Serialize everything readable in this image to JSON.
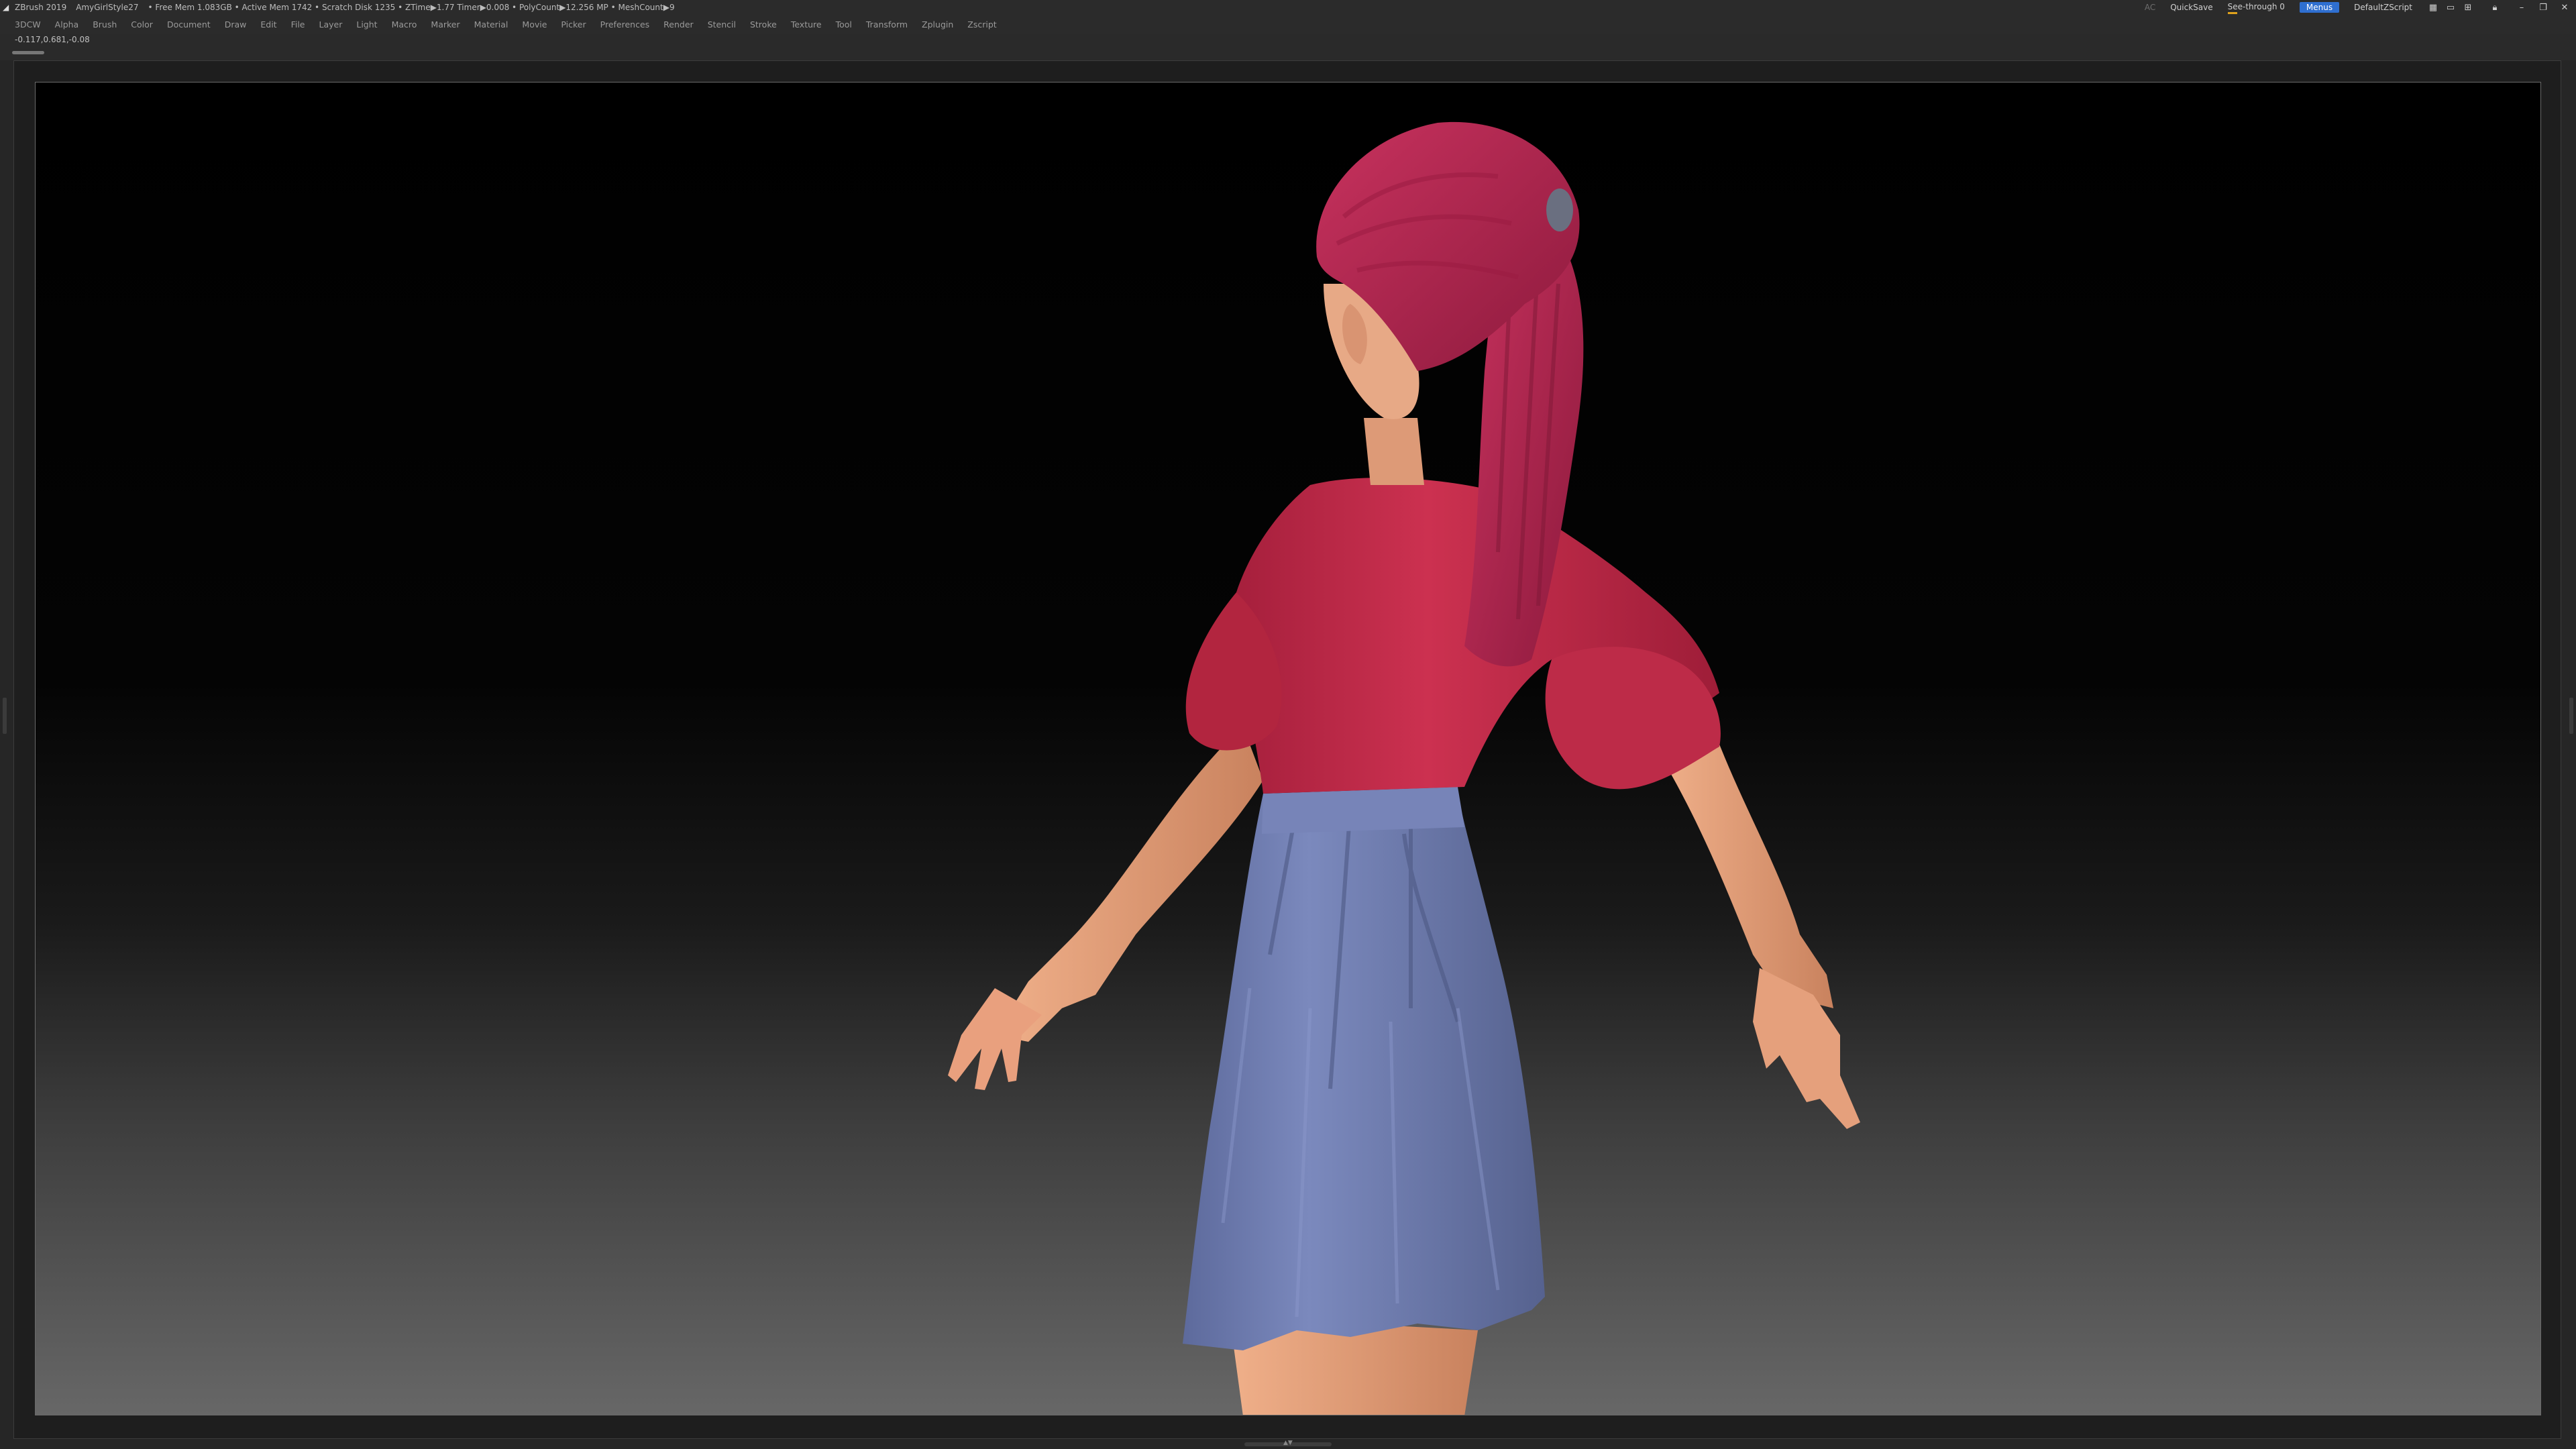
{
  "titlebar": {
    "app": "ZBrush 2019",
    "document": "AmyGirlStyle27",
    "stats": "• Free Mem 1.083GB • Active Mem 1742 • Scratch Disk 1235 • ZTime▶1.77 Timer▶0.008 • PolyCount▶12.256 MP • MeshCount▶9",
    "ac": "AC",
    "quicksave": "QuickSave",
    "see_through": "See-through  0",
    "menus": "Menus",
    "script": "DefaultZScript"
  },
  "menubar": [
    "3DCW",
    "Alpha",
    "Brush",
    "Color",
    "Document",
    "Draw",
    "Edit",
    "File",
    "Layer",
    "Light",
    "Macro",
    "Marker",
    "Material",
    "Movie",
    "Picker",
    "Preferences",
    "Render",
    "Stencil",
    "Stroke",
    "Texture",
    "Tool",
    "Transform",
    "Zplugin",
    "Zscript"
  ],
  "status": {
    "coords": "-0.117,0.681,-0.08"
  },
  "colors": {
    "hair": "#b4244e",
    "shirt": "#c22a47",
    "skirt": "#6a78ab",
    "skin": "#e6a47f",
    "accent": "#2f6fd0"
  },
  "window_icons": [
    "grid-icon",
    "folder-icon",
    "layout-icon",
    "lock-icon",
    "minimize-icon",
    "restore-icon",
    "close-icon"
  ]
}
